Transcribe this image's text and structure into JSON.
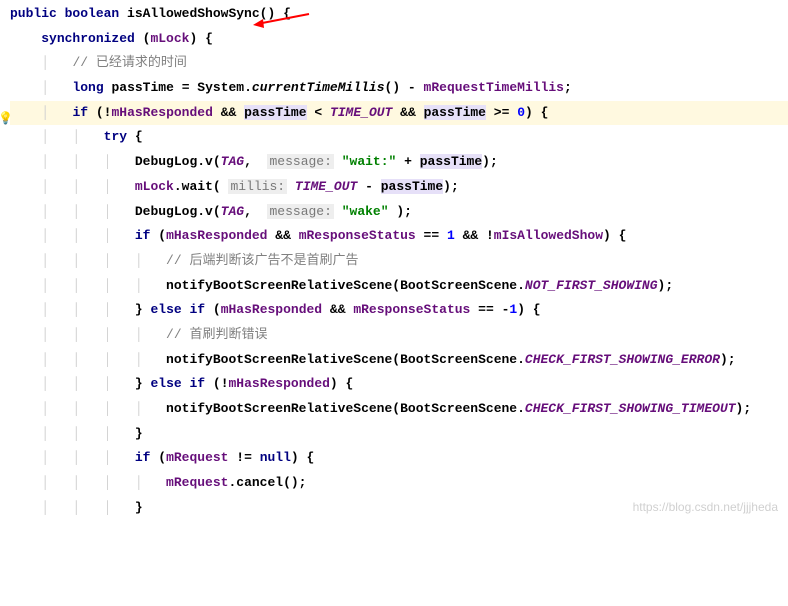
{
  "method": {
    "modifiers": "public boolean",
    "name": "isAllowedShowSync",
    "params": "()",
    "open": " {"
  },
  "sync": {
    "kw": "synchronized",
    "obj": "mLock",
    "open": " {"
  },
  "c1": "// 已经请求的时间",
  "pass": {
    "type": "long",
    "var": "passTime",
    "eq": " = System.",
    "method": "currentTimeMillis",
    "tail": "() - ",
    "field": "mRequestTimeMillis",
    "semi": ";"
  },
  "ifc": {
    "kw": "if",
    "neg": "!",
    "f1": "mHasResponded",
    "and1": " && ",
    "v1": "passTime",
    "lt": " < ",
    "cst": "TIME_OUT",
    "and2": " && ",
    "v2": "passTime",
    "ge": " >= ",
    "zero": "0",
    "close": ") {"
  },
  "try": "try",
  "l1": {
    "call": "DebugLog.v(",
    "tag": "TAG",
    "hint": "message:",
    "s": "\"wait:\"",
    "plus": " + ",
    "var": "passTime",
    "close": ");"
  },
  "l2": {
    "obj": "mLock",
    "wait": ".wait(",
    "hint": "millis:",
    "cst": "TIME_OUT",
    "minus": " - ",
    "var": "passTime",
    "close": ");"
  },
  "l3": {
    "call": "DebugLog.v(",
    "tag": "TAG",
    "hint": "message:",
    "s": "\"wake\"",
    "close": " );"
  },
  "if2": {
    "kw": "if",
    "f1": "mHasResponded",
    "and1": " && ",
    "f2": "mResponseStatus",
    "eq": " == ",
    "one": "1",
    "and2": " && !",
    "f3": "mIsAllowedShow",
    "close": ") {"
  },
  "c2": "// 后端判断该广告不是首刷广告",
  "n1": {
    "call": "notifyBootScreenRelativeScene(BootScreenScene.",
    "cst": "NOT_FIRST_SHOWING",
    "close": ");"
  },
  "ei1": {
    "close": "}",
    "else": "else if",
    "f1": "mHasResponded",
    "and": " && ",
    "f2": "mResponseStatus",
    "eq": " == -",
    "one": "1",
    "tail": ") {"
  },
  "c3": "// 首刷判断错误",
  "n2": {
    "call": "notifyBootScreenRelativeScene(BootScreenScene.",
    "cst": "CHECK_FIRST_SHOWING_ERROR",
    "close": ");"
  },
  "ei2": {
    "close": "}",
    "else": "else if",
    "neg": "!",
    "f1": "mHasResponded",
    "tail": ") {"
  },
  "n3": {
    "call": "notifyBootScreenRelativeScene(BootScreenScene.",
    "cst": "CHECK_FIRST_SHOWING_TIMEOUT",
    "close": ");"
  },
  "brace": "}",
  "if3": {
    "kw": "if",
    "f": "mRequest",
    "ne": " != ",
    "null": "null",
    "close": ") {"
  },
  "can": {
    "f": "mRequest",
    "call": ".cancel();"
  },
  "watermark": "https://blog.csdn.net/jjjheda"
}
